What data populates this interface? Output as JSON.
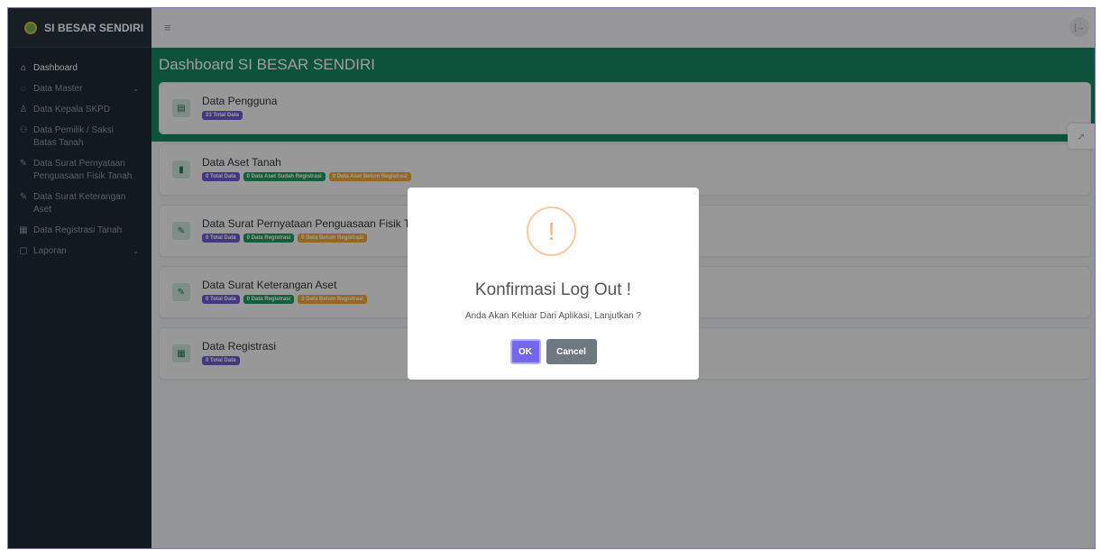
{
  "app": {
    "title": "SI BESAR SENDIRI"
  },
  "sidebar": {
    "items": [
      {
        "label": "Dashboard",
        "icon": "home-icon",
        "active": true
      },
      {
        "label": "Data Master",
        "icon": "database-icon",
        "chevron": true
      },
      {
        "label": "Data Kepala SKPD",
        "icon": "user-icon"
      },
      {
        "label": "Data Pemilik / Saksi Batas Tanah",
        "icon": "users-icon"
      },
      {
        "label": "Data Surat Pernyataan Penguasaan Fisik Tanah",
        "icon": "document-edit-icon"
      },
      {
        "label": "Data Surat Keterangan Aset",
        "icon": "document-edit-icon"
      },
      {
        "label": "Data Registrasi Tanah",
        "icon": "table-icon"
      },
      {
        "label": "Laporan",
        "icon": "file-icon",
        "chevron": true
      }
    ]
  },
  "topbar": {
    "menu_icon": "hamburger-icon",
    "logout_icon": "logout-icon"
  },
  "main": {
    "title": "Dashboard SI BESAR SENDIRI",
    "cards": [
      {
        "title": "Data Pengguna",
        "icon": "users-table-icon",
        "badges": [
          {
            "text": "23 Total Data",
            "color": "purple"
          }
        ]
      },
      {
        "title": "Data Aset Tanah",
        "icon": "file-icon",
        "badges": [
          {
            "text": "0 Total Data",
            "color": "purple"
          },
          {
            "text": "0 Data Aset Sudah Registrasi",
            "color": "green"
          },
          {
            "text": "0 Data Aset Belum Registrasi",
            "color": "orange"
          }
        ]
      },
      {
        "title": "Data Surat Pernyataan Penguasaan Fisik Ta",
        "icon": "document-edit-icon",
        "badges": [
          {
            "text": "0 Total Data",
            "color": "purple"
          },
          {
            "text": "0 Data Registrasi",
            "color": "green"
          },
          {
            "text": "0 Data Belum Registrasi",
            "color": "orange"
          }
        ]
      },
      {
        "title": "Data Surat Keterangan Aset",
        "icon": "document-edit-icon",
        "badges": [
          {
            "text": "0 Total Data",
            "color": "purple"
          },
          {
            "text": "0 Data Registrasi",
            "color": "green"
          },
          {
            "text": "0 Data Belum Registrasi",
            "color": "orange"
          }
        ]
      },
      {
        "title": "Data Registrasi",
        "icon": "table-icon",
        "badges": [
          {
            "text": "0 Total Data",
            "color": "purple"
          }
        ]
      }
    ]
  },
  "modal": {
    "icon": "warning-icon",
    "title": "Konfirmasi Log Out !",
    "message": "Anda Akan Keluar Dari Aplikasi, Lanjutkan ?",
    "ok_label": "OK",
    "cancel_label": "Cancel"
  },
  "colors": {
    "sidebar": "#1e2a33",
    "accent_green": "#16865f",
    "ok_purple": "#7367f0",
    "cancel_gray": "#6e7881",
    "warning_orange": "#f3b27a"
  }
}
